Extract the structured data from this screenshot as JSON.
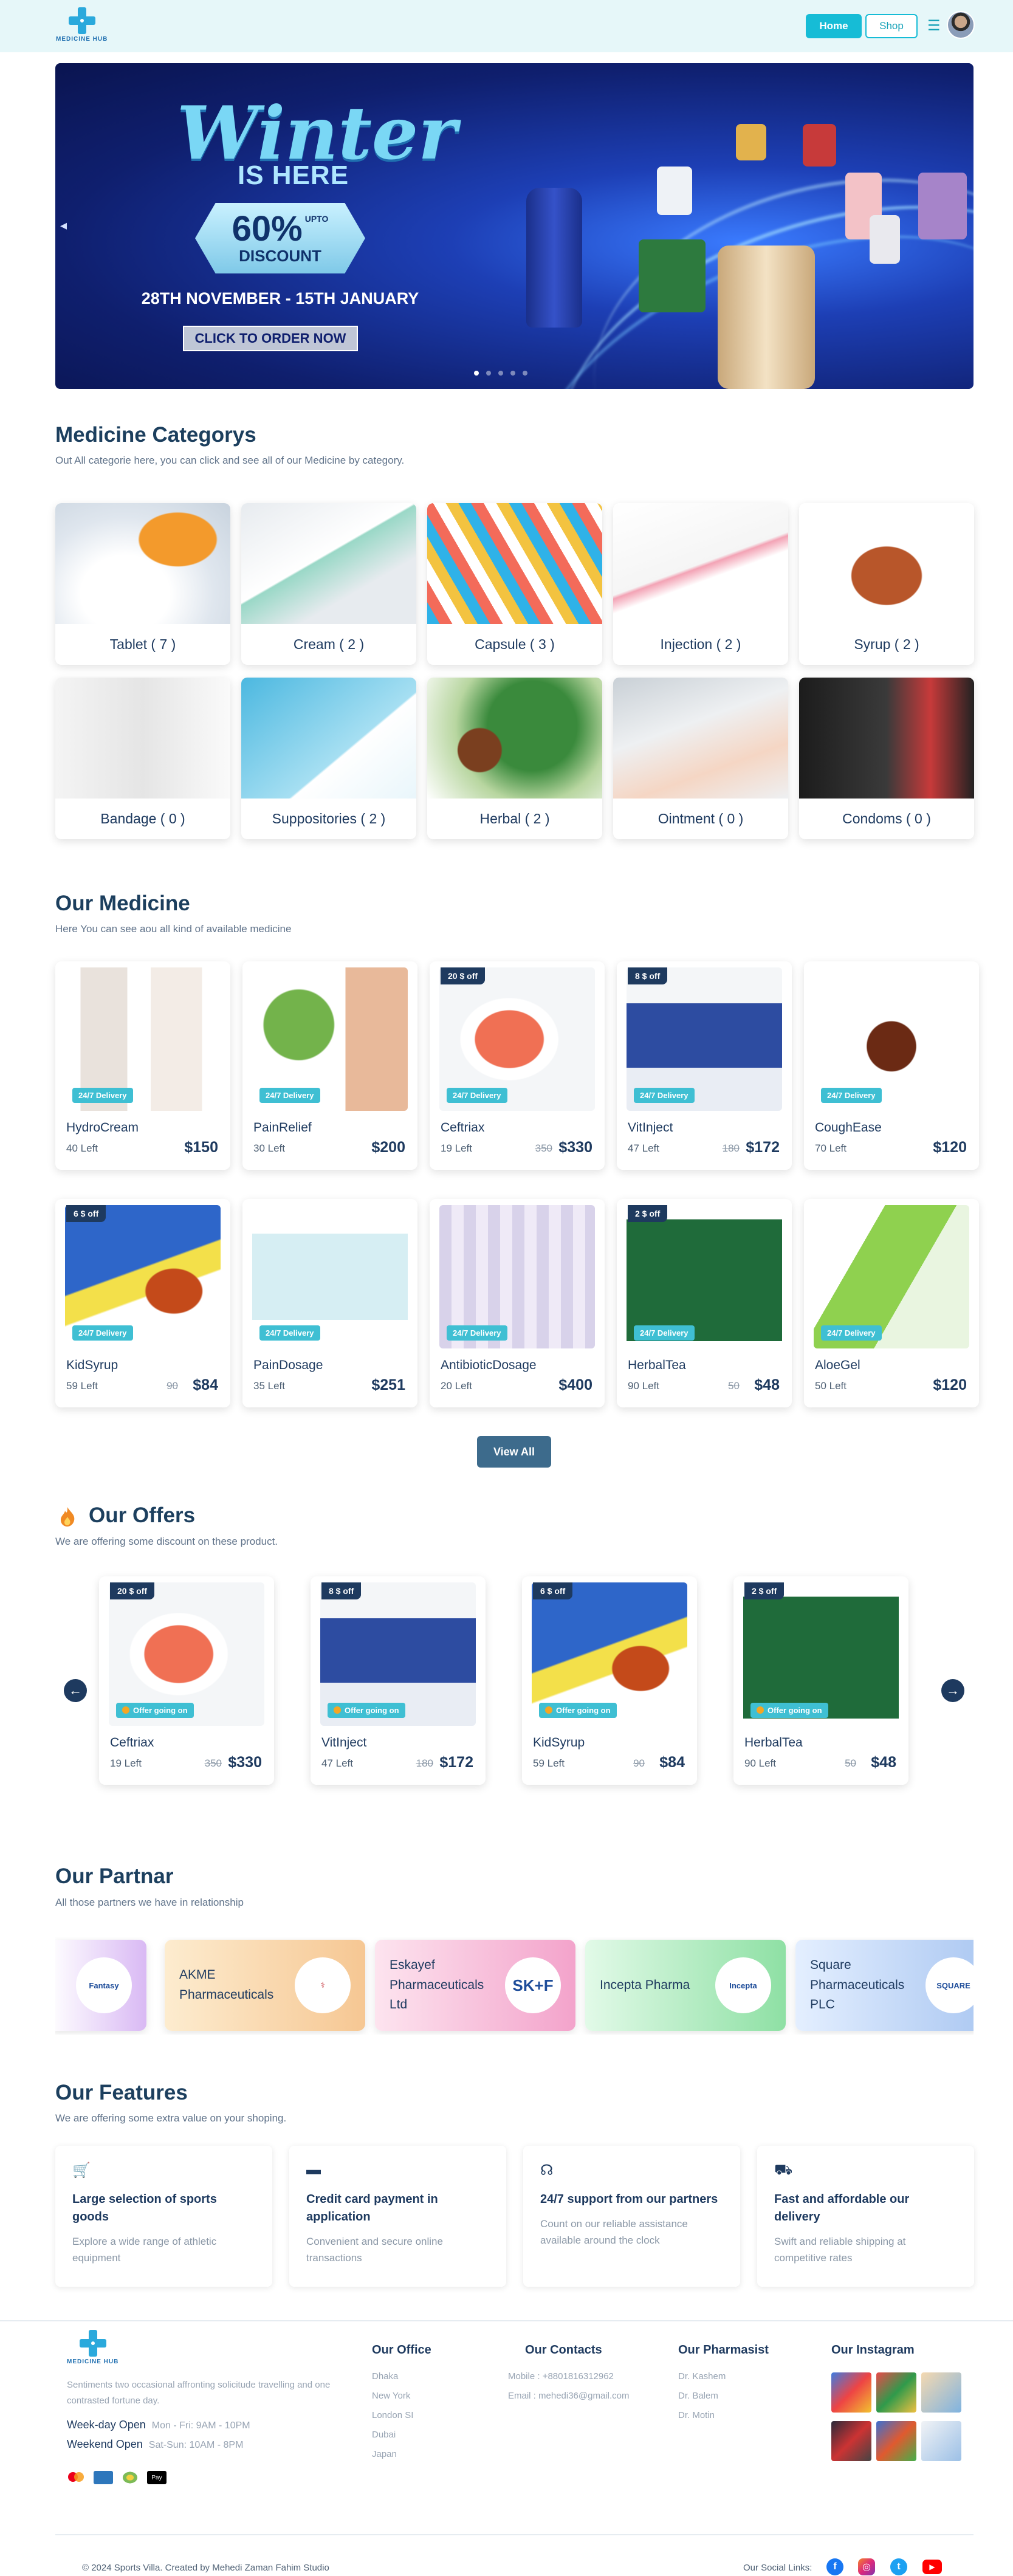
{
  "nav": {
    "logo_text": "MEDICINE HUB",
    "home": "Home",
    "shop": "Shop",
    "menu_icon": "☰"
  },
  "hero": {
    "title_script": "Winter",
    "title_sub": "IS HERE",
    "discount_pct": "60%",
    "discount_upto": "UPTO",
    "discount_word": "DISCOUNT",
    "date": "28TH NOVEMBER - 15TH JANUARY",
    "cta": "CLICK TO ORDER NOW",
    "slides": 5,
    "active_slide": 1
  },
  "categories": {
    "title": "Medicine Categorys",
    "subtitle": "Out All categorie here, you can click and see all of our Medicine by category.",
    "items": [
      {
        "label": "Tablet ( 7 )"
      },
      {
        "label": "Cream ( 2 )"
      },
      {
        "label": "Capsule ( 3 )"
      },
      {
        "label": "Injection ( 2 )"
      },
      {
        "label": "Syrup ( 2 )"
      },
      {
        "label": "Bandage ( 0 )"
      },
      {
        "label": "Suppositories ( 2 )"
      },
      {
        "label": "Herbal ( 2 )"
      },
      {
        "label": "Ointment ( 0 )"
      },
      {
        "label": "Condoms ( 0 )"
      }
    ]
  },
  "medicine": {
    "title": "Our Medicine",
    "subtitle": "Here You can see aou all kind of available medicine",
    "delivery": "24/7 Delivery",
    "view_all": "View All",
    "items": [
      {
        "name": "HydroCream",
        "left": "40 Left",
        "old": "",
        "price": "$150",
        "off": ""
      },
      {
        "name": "PainRelief",
        "left": "30 Left",
        "old": "",
        "price": "$200",
        "off": ""
      },
      {
        "name": "Ceftriax",
        "left": "19 Left",
        "old": "350",
        "price": "$330",
        "off": "20 $ off"
      },
      {
        "name": "VitInject",
        "left": "47 Left",
        "old": "180",
        "price": "$172",
        "off": "8 $ off"
      },
      {
        "name": "CoughEase",
        "left": "70 Left",
        "old": "",
        "price": "$120",
        "off": ""
      },
      {
        "name": "KidSyrup",
        "left": "59 Left",
        "old": "90",
        "price": "$84",
        "off": "6 $ off"
      },
      {
        "name": "PainDosage",
        "left": "35 Left",
        "old": "",
        "price": "$251",
        "off": ""
      },
      {
        "name": "AntibioticDosage",
        "left": "20 Left",
        "old": "",
        "price": "$400",
        "off": ""
      },
      {
        "name": "HerbalTea",
        "left": "90 Left",
        "old": "50",
        "price": "$48",
        "off": "2 $ off"
      },
      {
        "name": "AloeGel",
        "left": "50 Left",
        "old": "",
        "price": "$120",
        "off": ""
      }
    ]
  },
  "offers": {
    "title": "Our Offers",
    "subtitle": "We are offering some discount on these product.",
    "badge": "Offer going on",
    "items": [
      {
        "name": "Ceftriax",
        "left": "19 Left",
        "old": "350",
        "price": "$330",
        "off": "20 $ off"
      },
      {
        "name": "VitInject",
        "left": "47 Left",
        "old": "180",
        "price": "$172",
        "off": "8 $ off"
      },
      {
        "name": "KidSyrup",
        "left": "59 Left",
        "old": "90",
        "price": "$84",
        "off": "6 $ off"
      },
      {
        "name": "HerbalTea",
        "left": "90 Left",
        "old": "50",
        "price": "$48",
        "off": "2 $ off"
      }
    ]
  },
  "partners": {
    "title": "Our Partnar",
    "subtitle": "All those partners we have in relationship",
    "items": [
      {
        "name": "",
        "logo": "Fantasy"
      },
      {
        "name": "AKME Pharmaceuticals",
        "logo": "⚕"
      },
      {
        "name": "Eskayef Pharmaceuticals Ltd",
        "logo": "SK+F"
      },
      {
        "name": "Incepta Pharma",
        "logo": "Incepta"
      },
      {
        "name": "Square Pharmaceuticals PLC",
        "logo": "SQUARE"
      }
    ]
  },
  "features": {
    "title": "Our Features",
    "subtitle": "We are offering some extra value on your shoping.",
    "items": [
      {
        "icon": "cart-icon",
        "title": "Large selection of sports goods",
        "desc": "Explore a wide range of athletic equipment"
      },
      {
        "icon": "credit-card-icon",
        "title": "Credit card payment in application",
        "desc": "Convenient and secure online transactions"
      },
      {
        "icon": "headset-icon",
        "title": "24/7 support from our partners",
        "desc": "Count on our reliable assistance available around the clock"
      },
      {
        "icon": "truck-icon",
        "title": "Fast and affordable our delivery",
        "desc": "Swift and reliable shipping at competitive rates"
      }
    ]
  },
  "footer": {
    "logo_text": "MEDICINE HUB",
    "about": "Sentiments two occasional affronting solicitude travelling and one contrasted fortune day.",
    "weekday_label": "Week-day Open",
    "weekday_hours": "Mon - Fri: 9AM - 10PM",
    "weekend_label": "Weekend Open",
    "weekend_hours": "Sat-Sun: 10AM - 8PM",
    "office_title": "Our Office",
    "office": [
      "Dhaka",
      "New York",
      "London SI",
      "Dubai",
      "Japan"
    ],
    "contacts_title": "Our Contacts",
    "mobile": "Mobile : +8801816312962",
    "email": "Email : mehedi36@gmail.com",
    "pharmacist_title": "Our Pharmasist",
    "pharmacists": [
      "Dr. Kashem",
      "Dr. Balem",
      "Dr. Motin"
    ],
    "instagram_title": "Our Instagram",
    "copyright": "© 2024 Sports Villa. Created by Mehedi Zaman Fahim Studio",
    "social_label": "Our Social Links:"
  }
}
